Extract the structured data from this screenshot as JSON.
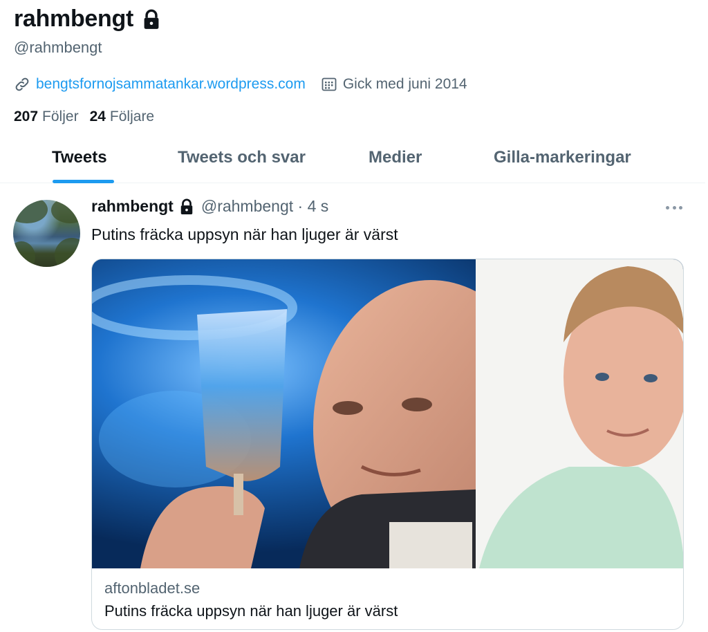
{
  "profile": {
    "display_name": "rahmbengt",
    "handle": "@rahmbengt",
    "website": "bengtsfornojsammatankar.wordpress.com",
    "joined": "Gick med juni 2014",
    "following_count": "207",
    "following_label": "Följer",
    "followers_count": "24",
    "followers_label": "Följare",
    "locked_icon": "lock-icon"
  },
  "tabs": [
    {
      "label": "Tweets",
      "active": true
    },
    {
      "label": "Tweets och svar",
      "active": false
    },
    {
      "label": "Medier",
      "active": false
    },
    {
      "label": "Gilla-markeringar",
      "active": false
    }
  ],
  "tweet": {
    "author": "rahmbengt",
    "handle": "@rahmbengt",
    "time": "4 s",
    "text": "Putins fräcka uppsyn när han ljuger är värst",
    "card": {
      "domain": "aftonbladet.se",
      "title": "Putins fräcka uppsyn när han ljuger är värst"
    }
  },
  "colors": {
    "accent": "#1d9bf0",
    "secondary_text": "#536471",
    "primary_text": "#0f1419",
    "border": "#cfd9de"
  }
}
